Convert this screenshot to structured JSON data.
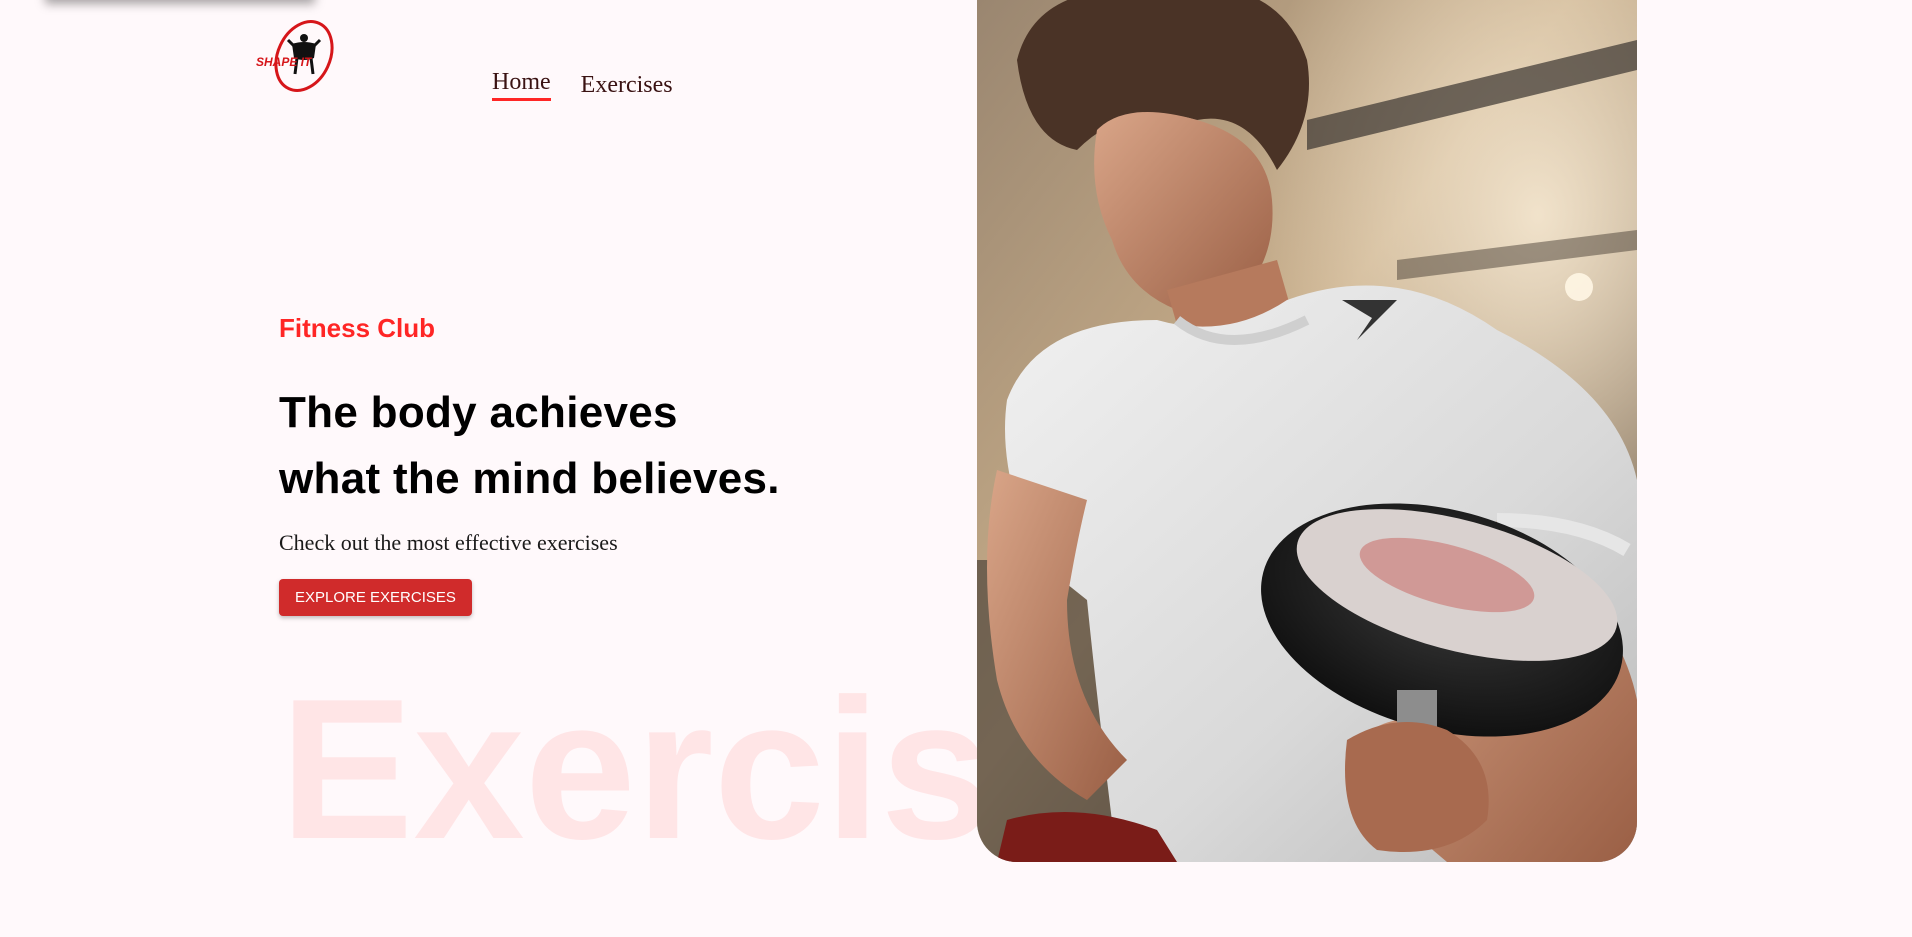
{
  "brand": {
    "logo_text": "SHAPE IT",
    "accent_color": "#ff2625",
    "button_color": "#d02b2b",
    "background_color": "#fff9fb"
  },
  "nav": {
    "items": [
      {
        "label": "Home",
        "active": true
      },
      {
        "label": "Exercises",
        "active": false
      }
    ]
  },
  "hero": {
    "eyebrow": "Fitness Club",
    "headline_line1": "The body achieves",
    "headline_line2": "what the mind believes.",
    "subtext": "Check out the most effective exercises",
    "cta_label": "EXPLORE EXERCISES",
    "watermark": "Exercises",
    "image_subject": "man-lifting-dumbbell-photo"
  }
}
